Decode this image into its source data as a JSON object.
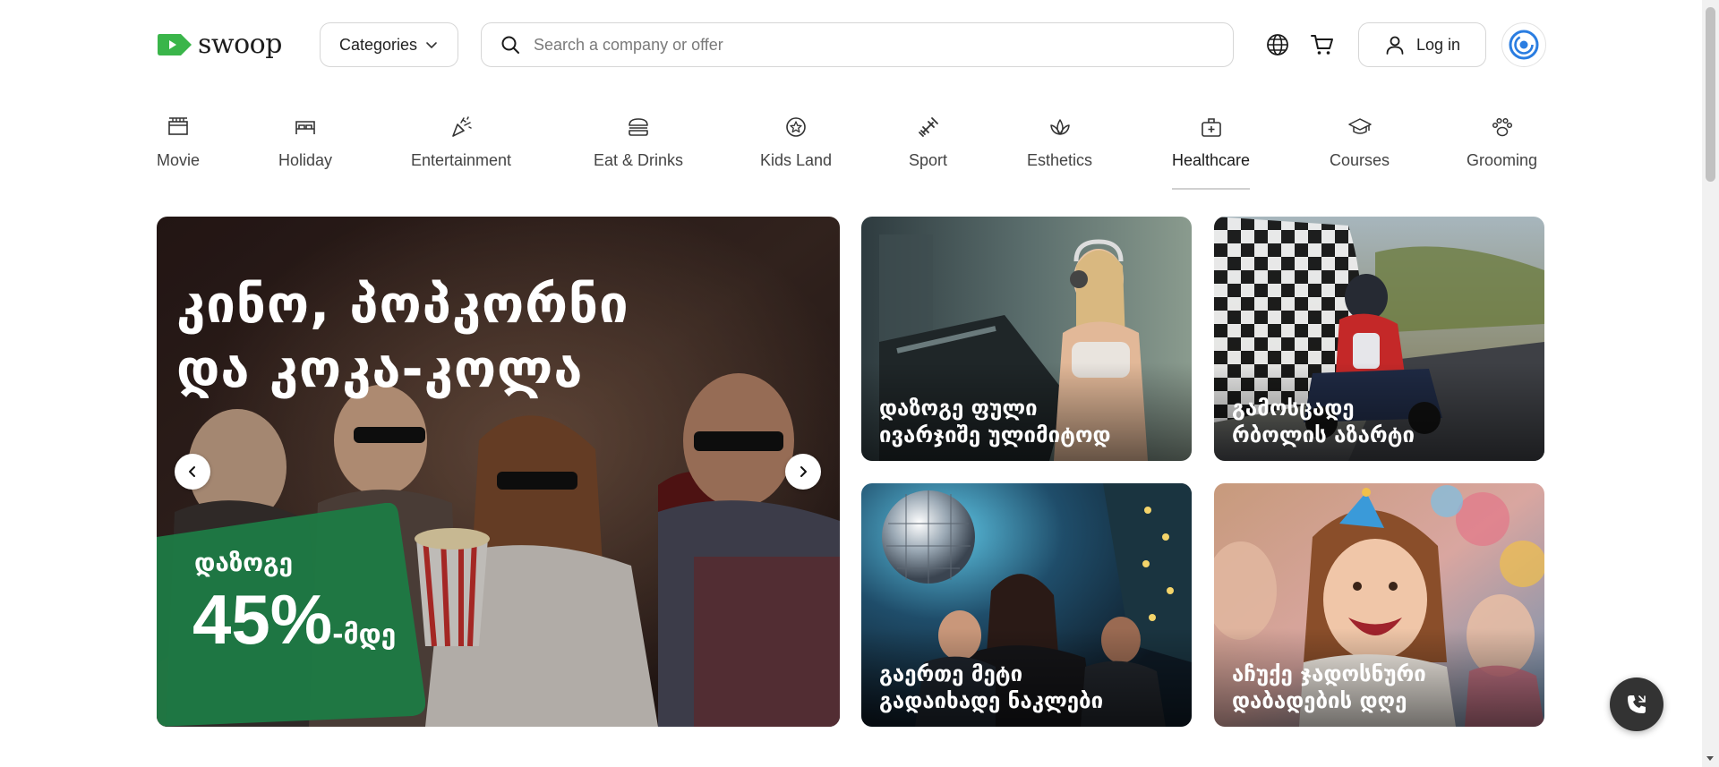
{
  "header": {
    "logo_text": "swoop",
    "categories_label": "Categories",
    "search_placeholder": "Search a company or offer",
    "login_label": "Log in",
    "brand_color": "#3ab54a"
  },
  "category_nav": [
    {
      "label": "Movie",
      "icon": "movie-icon"
    },
    {
      "label": "Holiday",
      "icon": "bed-icon"
    },
    {
      "label": "Entertainment",
      "icon": "party-popper-icon"
    },
    {
      "label": "Eat & Drinks",
      "icon": "burger-icon"
    },
    {
      "label": "Kids Land",
      "icon": "star-badge-icon"
    },
    {
      "label": "Sport",
      "icon": "dumbbell-icon"
    },
    {
      "label": "Esthetics",
      "icon": "lotus-icon"
    },
    {
      "label": "Healthcare",
      "icon": "medical-kit-icon",
      "active": true
    },
    {
      "label": "Courses",
      "icon": "graduation-cap-icon"
    },
    {
      "label": "Grooming",
      "icon": "paw-icon"
    }
  ],
  "hero": {
    "title_line1": "კინო, პოპკორნი",
    "title_line2": "და კოკა-კოლა",
    "discount_label": "დაზოგე",
    "discount_value": "45%",
    "discount_suffix": "-მდე",
    "discount_color": "#1e7a45"
  },
  "tiles": [
    {
      "line1": "დაზოგე ფული",
      "line2": "ივარჯიშე ულიმიტოდ"
    },
    {
      "line1": "გამოსცადე",
      "line2": "რბოლის აზარტი"
    },
    {
      "line1": "გაერთე მეტი",
      "line2": "გადაიხადე ნაკლები"
    },
    {
      "line1": "აჩუქე ჯადოსნური",
      "line2": "დაბადების დღე"
    }
  ]
}
